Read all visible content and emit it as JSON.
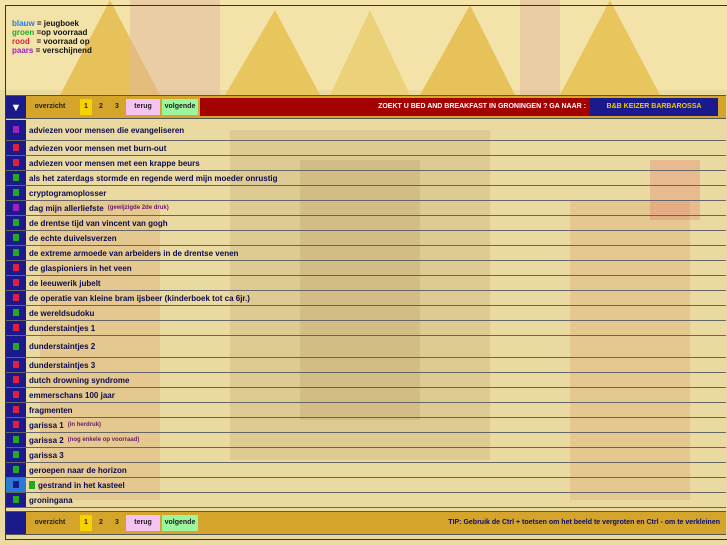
{
  "colors": {
    "blauw": "#2a7ad8",
    "groen": "#22aa22",
    "rood": "#e0203a",
    "paars": "#a020c0",
    "navy": "#1a1a8c",
    "gold": "#d4a52a"
  },
  "legend": [
    {
      "key": "blauw",
      "sep": " = jeugboek",
      "color": "#2a7ad8"
    },
    {
      "key": "groen",
      "sep": " =op voorraad",
      "color": "#22aa22"
    },
    {
      "key": "rood",
      "sep": "   = voorraad op",
      "color": "#e0203a"
    },
    {
      "key": "paars",
      "sep": " = verschijnend",
      "color": "#a020c0"
    }
  ],
  "nav_top": {
    "arrow": "▼",
    "overzicht": "overzicht",
    "page1": "1",
    "page2": "2",
    "page3": "3",
    "terug": "terug",
    "volgende": "volgende",
    "banner": "ZOEKT U BED AND BREAKFAST IN GRONINGEN ?  GA NAAR :",
    "bb_link": "B&B  KEIZER BARBAROSSA"
  },
  "nav_bottom": {
    "overzicht": "overzicht",
    "page1": "1",
    "page2": "2",
    "page3": "3",
    "terug": "terug",
    "volgende": "volgende",
    "tip": "TIP: Gebruik de Ctrl + toetsen om het beeld  te vergroten en  Ctrl -  om te verkleinen"
  },
  "items": [
    {
      "title": "adviezen voor mensen die evangeliseren",
      "color": "#a020c0",
      "note": ""
    },
    {
      "title": "adviezen voor mensen met burn-out",
      "color": "#e0203a",
      "note": ""
    },
    {
      "title": "adviezen voor mensen met een krappe beurs",
      "color": "#e0203a",
      "note": ""
    },
    {
      "title": "als het zaterdags stormde en regende werd mijn moeder onrustig",
      "color": "#22aa22",
      "note": ""
    },
    {
      "title": "cryptogramoplosser",
      "color": "#22aa22",
      "note": ""
    },
    {
      "title": "dag mijn allerliefste",
      "color": "#a020c0",
      "note": "(gewijzigde 2de druk)"
    },
    {
      "title": "de drentse tijd van vincent van gogh",
      "color": "#22aa22",
      "note": ""
    },
    {
      "title": "de echte duivelsverzen",
      "color": "#22aa22",
      "note": ""
    },
    {
      "title": "de extreme armoede van arbeiders in de drentse venen",
      "color": "#22aa22",
      "note": ""
    },
    {
      "title": "de glaspioniers in het veen",
      "color": "#e0203a",
      "note": ""
    },
    {
      "title": "de leeuwerik jubelt",
      "color": "#e0203a",
      "note": ""
    },
    {
      "title": "de operatie van kleine bram ijsbeer (kinderboek tot ca 6jr.)",
      "color": "#e0203a",
      "note": ""
    },
    {
      "title": "de wereldsudoku",
      "color": "#22aa22",
      "note": ""
    },
    {
      "title": "dunderstaintjes 1",
      "color": "#e0203a",
      "note": ""
    },
    {
      "title": "dunderstaintjes 2",
      "color": "#22aa22",
      "note": ""
    },
    {
      "title": "dunderstaintjes 3",
      "color": "#e0203a",
      "note": ""
    },
    {
      "title": "dutch drowning syndrome",
      "color": "#e0203a",
      "note": ""
    },
    {
      "title": "emmerschans 100 jaar",
      "color": "#e0203a",
      "note": ""
    },
    {
      "title": "fragmenten",
      "color": "#e0203a",
      "note": ""
    },
    {
      "title": "garissa 1",
      "color": "#e0203a",
      "note": "(in herdruk)"
    },
    {
      "title": "garissa 2",
      "color": "#22aa22",
      "note": "(nog enkele op voorraad)"
    },
    {
      "title": "garissa 3",
      "color": "#22aa22",
      "note": ""
    },
    {
      "title": "geroepen naar de horizon",
      "color": "#22aa22",
      "note": ""
    },
    {
      "title": "gestrand in het kasteel",
      "color": "#2a7ad8",
      "note": "",
      "inline": "#22aa22"
    },
    {
      "title": "groningana",
      "color": "#22aa22",
      "note": ""
    }
  ]
}
